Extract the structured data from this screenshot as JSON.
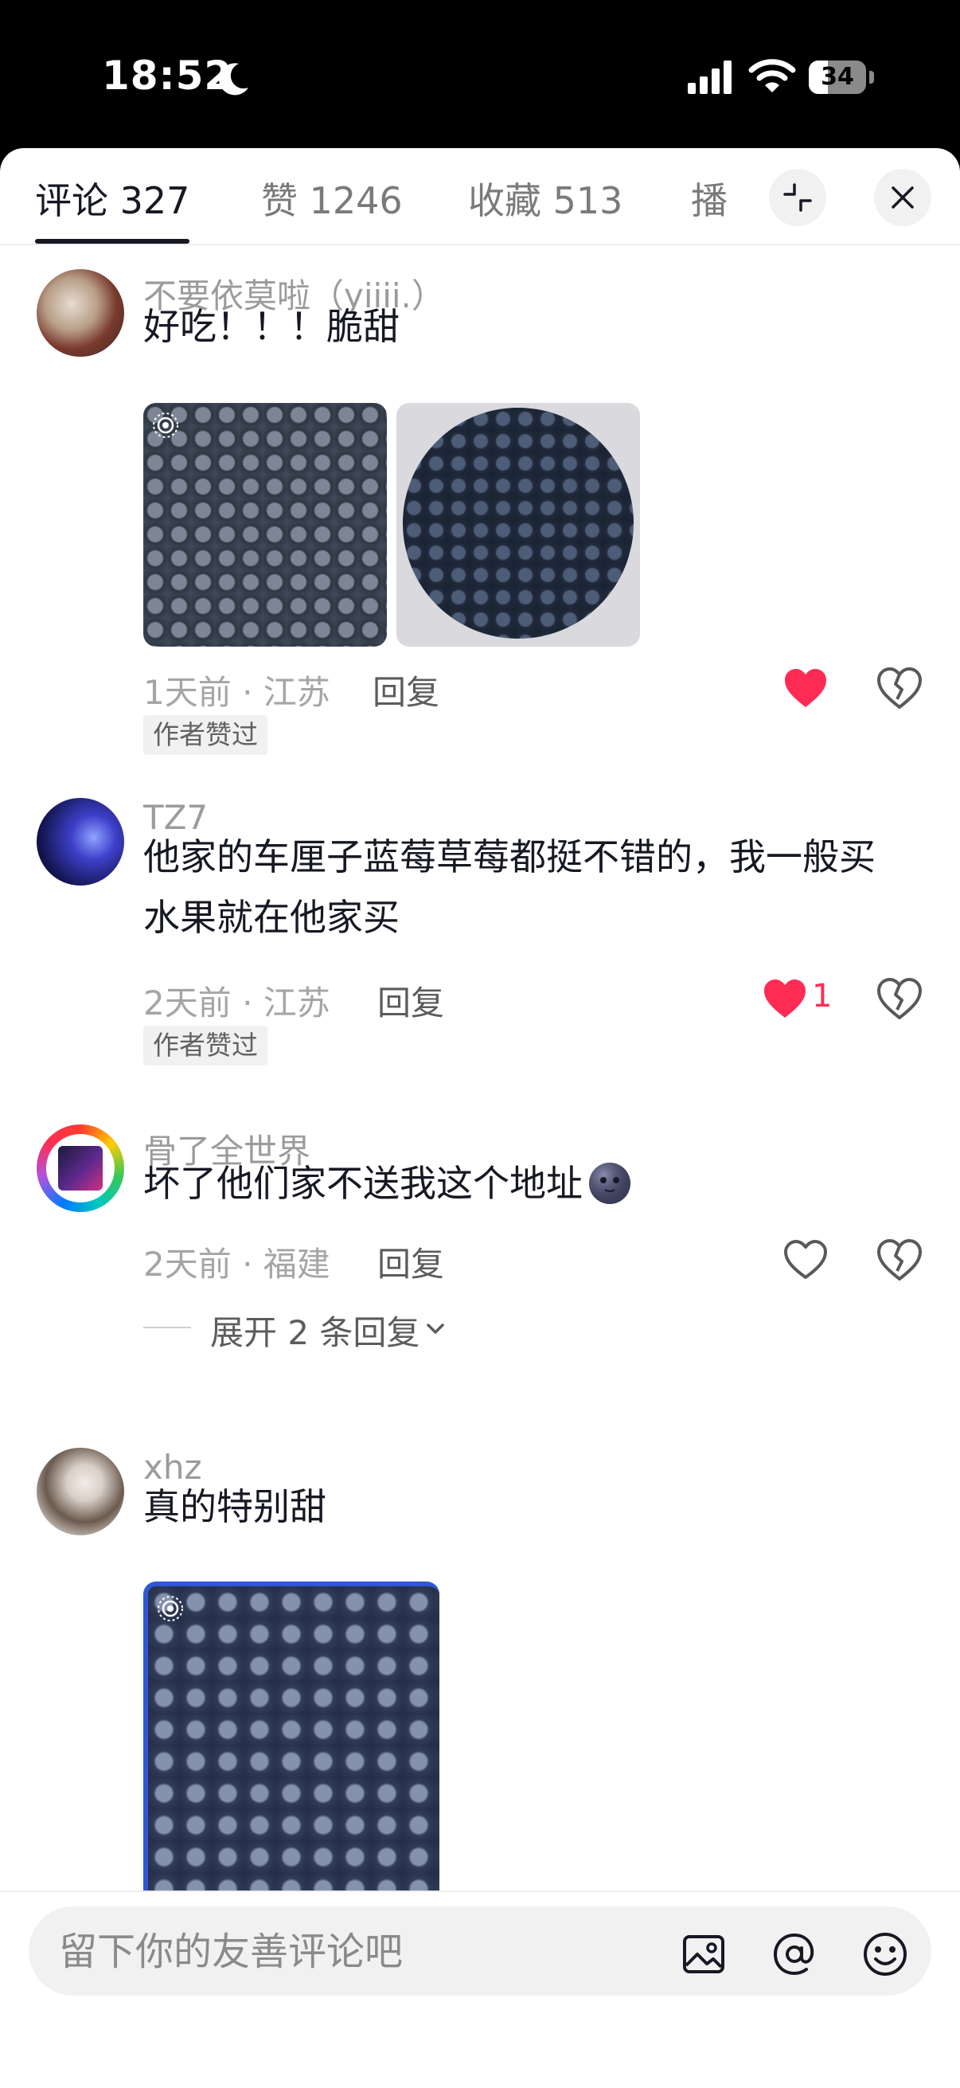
{
  "status_bar": {
    "time": "18:52",
    "battery": "34",
    "battery_level": 0.34
  },
  "tabs": [
    {
      "label": "评论 327",
      "active": true
    },
    {
      "label": "赞 1246",
      "active": false
    },
    {
      "label": "收藏 513",
      "active": false
    },
    {
      "label": "播",
      "active": false
    }
  ],
  "comments": [
    {
      "username": "不要依莫啦（yiiii.）",
      "text": "好吃！！！脆甜",
      "time_location": "1天前 · 江苏",
      "reply_label": "回复",
      "badge": "作者赞过",
      "liked": true,
      "like_count": ""
    },
    {
      "username": "TZ7",
      "text": "他家的车厘子蓝莓草莓都挺不错的，我一般买水果就在他家买",
      "time_location": "2天前 · 江苏",
      "reply_label": "回复",
      "badge": "作者赞过",
      "liked": true,
      "like_count": "1"
    },
    {
      "username": "骨了全世界",
      "text": "坏了他们家不送我这个地址",
      "time_location": "2天前 · 福建",
      "reply_label": "回复",
      "liked": false,
      "like_count": "",
      "expand_label": "展开 2 条回复"
    },
    {
      "username": "xhz",
      "text": "真的特别甜"
    }
  ],
  "composer": {
    "placeholder": "留下你的友善评论吧"
  },
  "colors": {
    "like_red": "#fe2c55",
    "text_dark": "#161823",
    "muted": "#9b9b9b"
  }
}
